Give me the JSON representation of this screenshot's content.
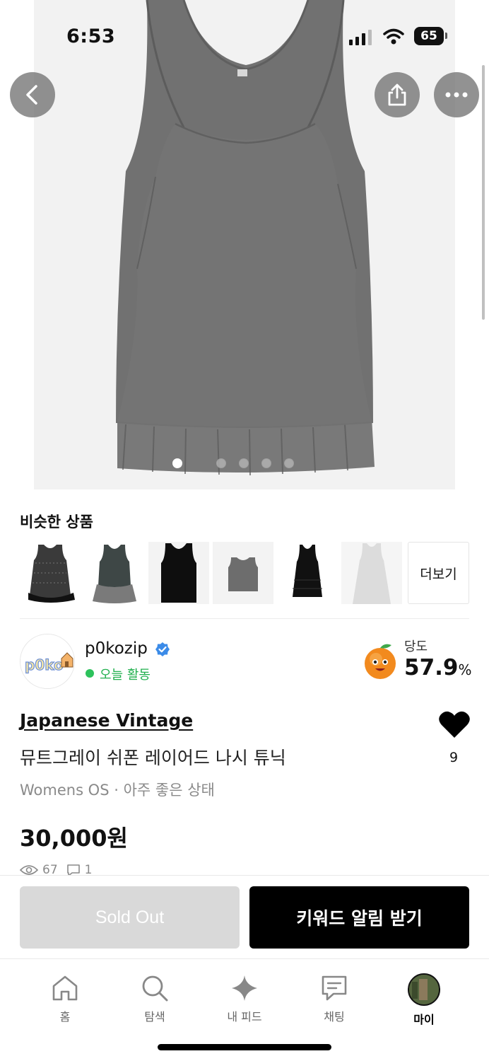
{
  "status_bar": {
    "time": "6:53",
    "battery": "65"
  },
  "similar": {
    "title": "비슷한 상품",
    "more_label": "더보기"
  },
  "seller": {
    "name": "p0kozip",
    "avatar_text": "p0ko",
    "activity": "오늘 활동",
    "sweetness_label": "당도",
    "sweetness_value": "57.9",
    "sweetness_unit": "%"
  },
  "product": {
    "brand": "Japanese Vintage",
    "title": "뮤트그레이 쉬폰 레이어드 나시 튜닉",
    "meta": "Womens OS · 아주 좋은 상태",
    "price": "30,000원",
    "likes": "9",
    "views": "67",
    "comments": "1"
  },
  "actions": {
    "sold_out": "Sold Out",
    "keyword_alert": "키워드 알림 받기"
  },
  "tabs": [
    {
      "label": "홈",
      "icon": "home-icon"
    },
    {
      "label": "탐색",
      "icon": "search-icon"
    },
    {
      "label": "내 피드",
      "icon": "sparkle-icon"
    },
    {
      "label": "채팅",
      "icon": "chat-icon"
    },
    {
      "label": "마이",
      "icon": "avatar"
    }
  ],
  "colors": {
    "accent_green": "#22b04f",
    "verified_blue": "#3b8be8",
    "product_gray": "#6f6f6f"
  },
  "carousel": {
    "pages": 5,
    "current": 1
  }
}
